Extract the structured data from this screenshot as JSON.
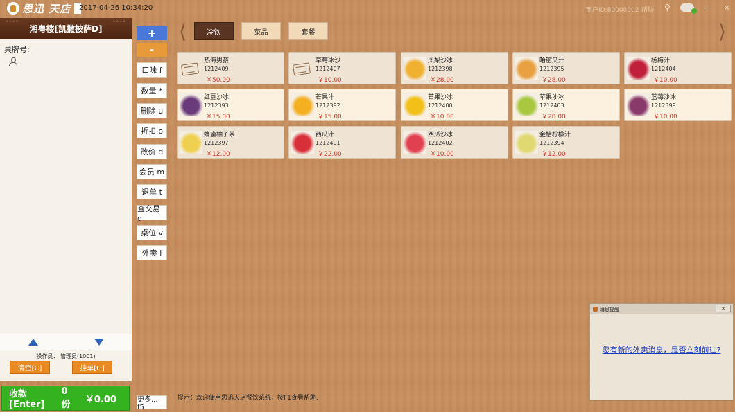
{
  "topbar": {
    "logo_text": "思迅 天店",
    "datetime": "2017-04-26 10:34:20",
    "merchant_id": "商户ID:80008002",
    "help": "帮助",
    "minimize": "-",
    "close": "×"
  },
  "left": {
    "store_name": "湘粤楼[凯撒披萨D]",
    "table_label": "桌牌号:",
    "operator": "操作员：  管理员(1001)",
    "clear_label": "清空[C]",
    "hold_label": "挂单[G]",
    "pay_label": "收款[Enter]",
    "count_label": "0份",
    "total_label": "￥0.00"
  },
  "actions": {
    "plus": "+",
    "minus": "-",
    "buttons": [
      "口味 f",
      "数量 *",
      "删除 u",
      "折扣 o",
      "改价 d",
      "会员 m",
      "退单 t",
      "查交易 q",
      "桌位 v",
      "外卖 i"
    ],
    "more": "更多... f5"
  },
  "categories": {
    "tabs": [
      "冷饮",
      "菜品",
      "套餐"
    ],
    "active_index": 0
  },
  "dishes": [
    {
      "name": "热海男孩",
      "code": "1212409",
      "price": "￥50.00",
      "img": "placeholder"
    },
    {
      "name": "草莓冰沙",
      "code": "1212407",
      "price": "￥10.00",
      "img": "placeholder"
    },
    {
      "name": "凤梨沙冰",
      "code": "1212398",
      "price": "￥28.00",
      "img": "#f0b030"
    },
    {
      "name": "哈密瓜汁",
      "code": "1212395",
      "price": "￥28.00",
      "img": "#e8a040"
    },
    {
      "name": "杨梅汁",
      "code": "1212404",
      "price": "￥10.00",
      "img": "#c0203a"
    },
    {
      "name": "红豆沙冰",
      "code": "1212393",
      "price": "￥15.00",
      "img": "#6a3a7a"
    },
    {
      "name": "芒果汁",
      "code": "1212392",
      "price": "￥15.00",
      "img": "#f4b020"
    },
    {
      "name": "芒果沙冰",
      "code": "1212400",
      "price": "￥10.00",
      "img": "#f2c018"
    },
    {
      "name": "苹果沙冰",
      "code": "1212403",
      "price": "￥28.00",
      "img": "#a8c840"
    },
    {
      "name": "蓝莓沙冰",
      "code": "1212399",
      "price": "￥10.00",
      "img": "#8a3a6a"
    },
    {
      "name": "蜂蜜柚子茶",
      "code": "1212397",
      "price": "￥12.00",
      "img": "#f0d050"
    },
    {
      "name": "西瓜汁",
      "code": "1212401",
      "price": "￥22.00",
      "img": "#d83038"
    },
    {
      "name": "西瓜沙冰",
      "code": "1212402",
      "price": "￥10.00",
      "img": "#e04050"
    },
    {
      "name": "金桔柠檬汁",
      "code": "1212394",
      "price": "￥12.00",
      "img": "#e0d870"
    }
  ],
  "tip": "提示：欢迎使用思迅天店餐饮系统，按F1查看帮助.",
  "popup": {
    "title": "消息提醒",
    "message": "您有新的外卖消息，是否立刻前往?",
    "close": "✕"
  }
}
